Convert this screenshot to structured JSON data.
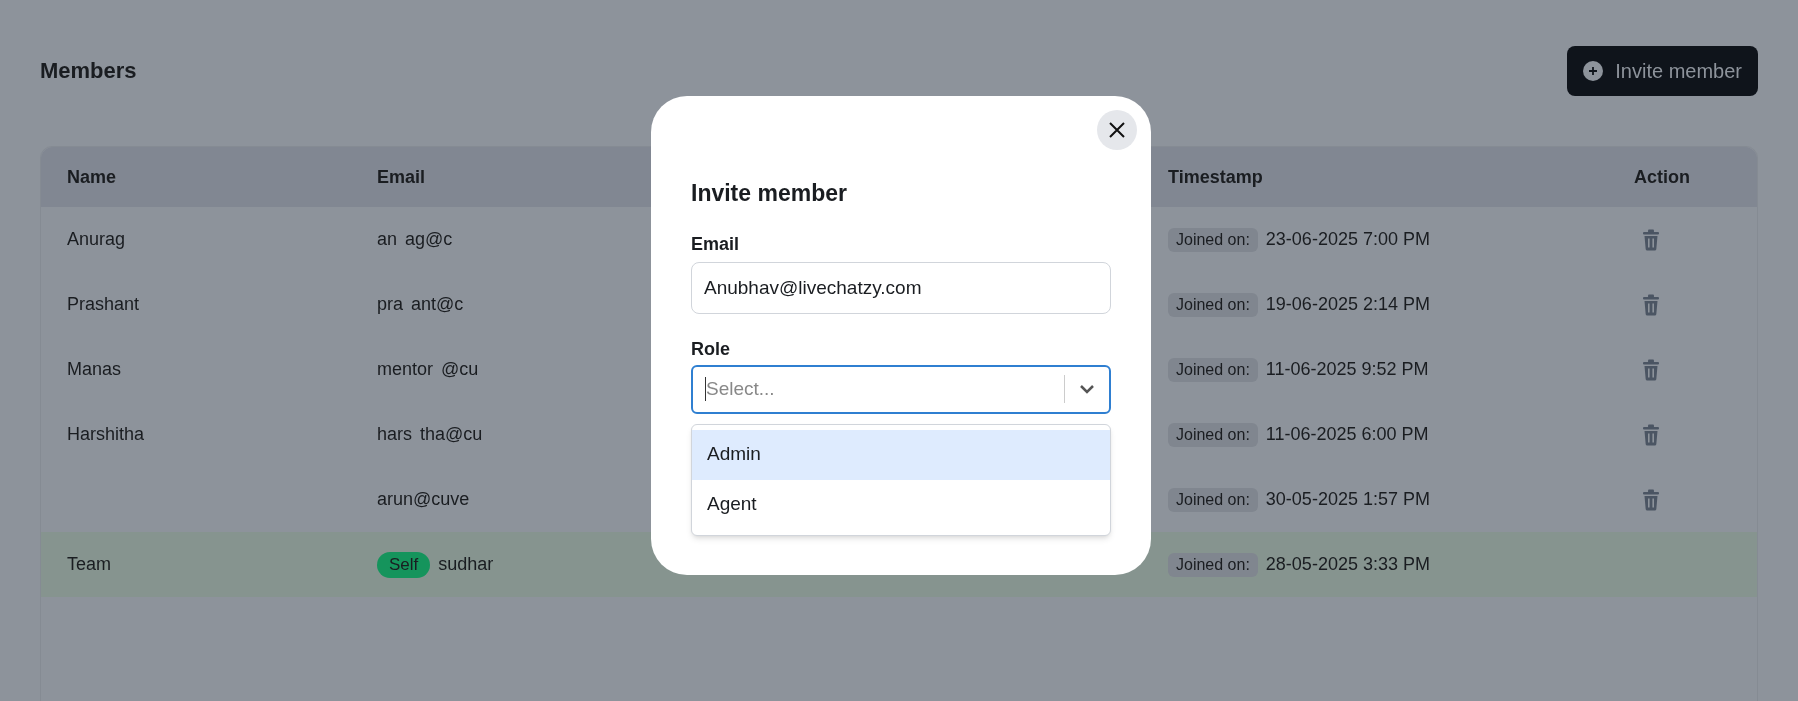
{
  "page": {
    "title": "Members",
    "invite_button": "Invite member"
  },
  "table": {
    "columns": [
      "Name",
      "Email",
      "Timestamp",
      "Action"
    ],
    "rows": [
      {
        "name": "Anurag",
        "email": "an",
        "email_2": "ag@c",
        "joined_label": "Joined on:",
        "timestamp": "23-06-2025 7:00 PM",
        "deletable": true,
        "self": false
      },
      {
        "name": "Prashant",
        "email": "pra",
        "email_2": "ant@c",
        "joined_label": "Joined on:",
        "timestamp": "19-06-2025 2:14 PM",
        "deletable": true,
        "self": false
      },
      {
        "name": "Manas",
        "email": "mentor",
        "email_2": "@cu",
        "joined_label": "Joined on:",
        "timestamp": "11-06-2025 9:52 PM",
        "deletable": true,
        "self": false
      },
      {
        "name": "Harshitha",
        "email": "hars",
        "email_2": "tha@cu",
        "joined_label": "Joined on:",
        "timestamp": "11-06-2025 6:00 PM",
        "deletable": true,
        "self": false
      },
      {
        "name": "",
        "email": "arun@cuve",
        "joined_label": "Joined on:",
        "timestamp": "30-05-2025 1:57 PM",
        "deletable": true,
        "self": false
      },
      {
        "name": "Team",
        "badge": "Self",
        "email": "sudhar",
        "joined_label": "Joined on:",
        "timestamp": "28-05-2025 3:33 PM",
        "deletable": false,
        "self": true
      }
    ]
  },
  "dialog": {
    "title": "Invite member",
    "email_label": "Email",
    "email_value": "Anubhav@livechatzy.com",
    "role_label": "Role",
    "role_placeholder": "Select...",
    "role_focused": true,
    "role_options": [
      {
        "label": "Admin",
        "selected": true
      },
      {
        "label": "Agent",
        "selected": false
      }
    ]
  }
}
